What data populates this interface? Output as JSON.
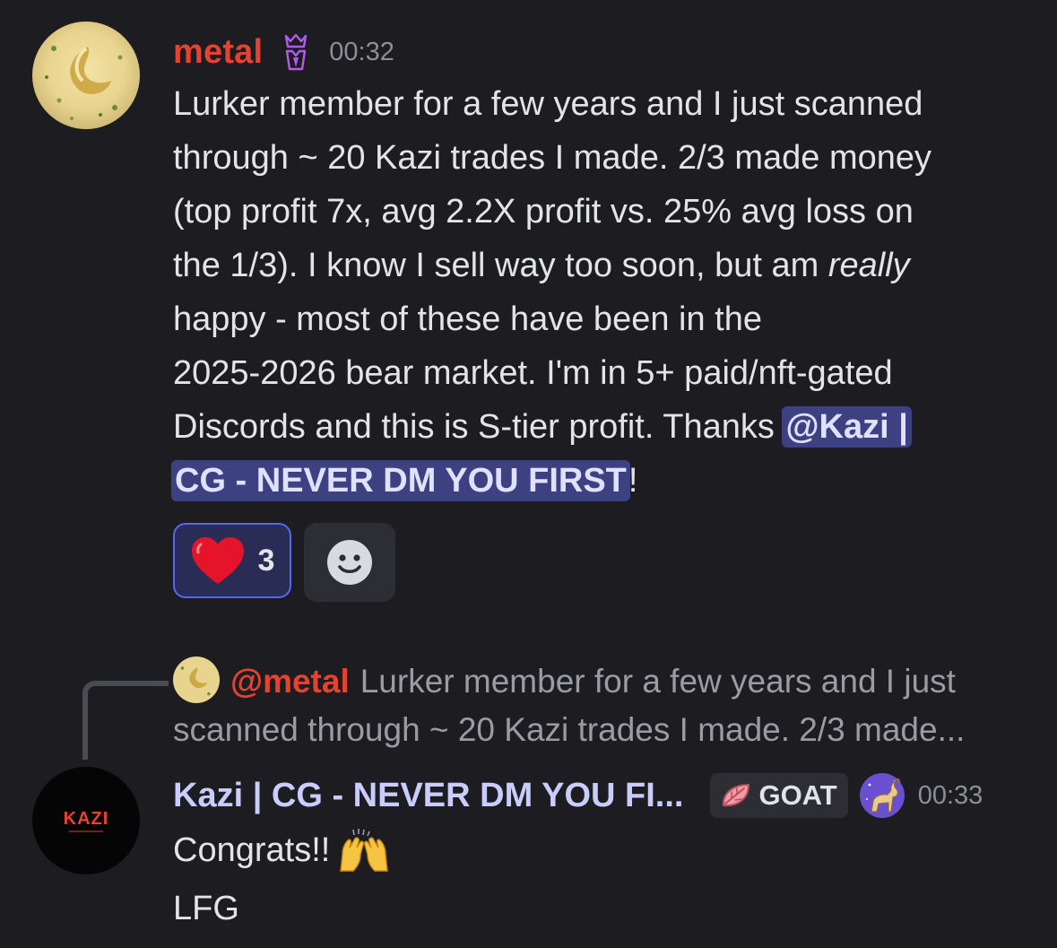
{
  "message1": {
    "author": "metal",
    "badge_icon": "crown-badge-icon",
    "timestamp": "00:32",
    "lines": [
      "Lurker member for a few years and I just scanned",
      "through ~ 20 Kazi trades I made. 2/3 made money",
      "(top profit 7x, avg 2.2X profit vs. 25% avg loss on",
      "happy - most of these have been in the",
      "2025-2026 bear market. I'm in 5+ paid/nft-gated",
      "Discords and this is S-tier profit. Thanks "
    ],
    "line4_before": "the 1/3). I know I sell way too soon, but am ",
    "line4_emphasis": "really",
    "mention_part1": "@Kazi |",
    "mention_part2": "CG - NEVER DM YOU FIRST",
    "trailing": "!",
    "reactions": [
      {
        "emoji_icon": "red-heart-icon",
        "count": "3",
        "selected": true
      }
    ],
    "add_reaction_icon": "smiley-icon"
  },
  "reply": {
    "author": "@metal",
    "preview_line1": "Lurker member for a few years and I just",
    "preview_line2": "scanned through ~ 20 Kazi trades I made. 2/3 made..."
  },
  "message2": {
    "avatar_text": "KAZI",
    "author": "Kazi | CG - NEVER DM YOU FI...",
    "role_tag": "GOAT",
    "role_icon": "pink-leaf-icon",
    "server_icon": "goat-icon",
    "timestamp": "00:33",
    "line1": "Congrats!!",
    "line1_emoji": "raised-hands-icon",
    "line2": "LFG"
  },
  "colors": {
    "background": "#1c1c21",
    "author_red": "#e8412f",
    "mention_bg": "#3d4181",
    "reaction_border": "#5865f2",
    "kazi_name": "#c9cdfb"
  }
}
